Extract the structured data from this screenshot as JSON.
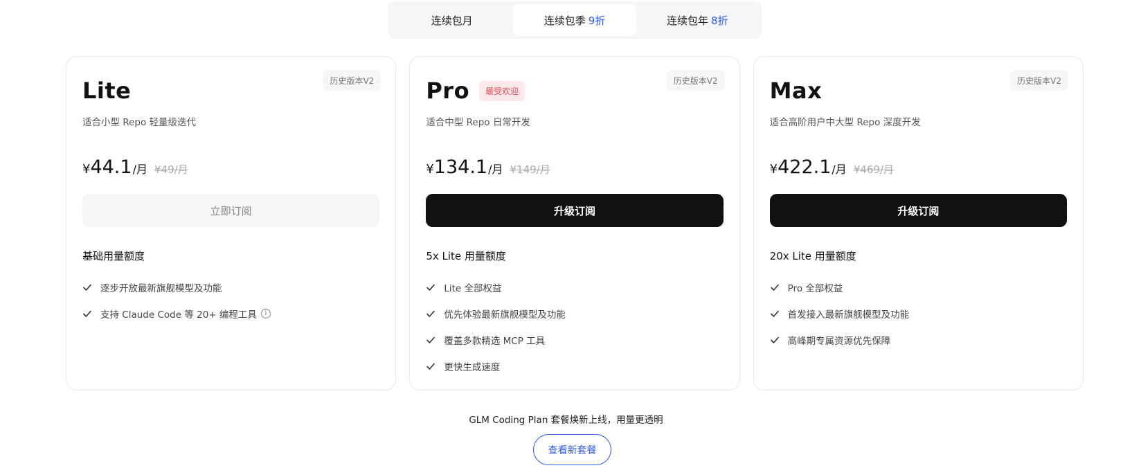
{
  "period_tabs": [
    {
      "label": "连续包月",
      "discount": ""
    },
    {
      "label": "连续包季",
      "discount": "9折"
    },
    {
      "label": "连续包年",
      "discount": "8折"
    }
  ],
  "active_period": 1,
  "plans": [
    {
      "name": "Lite",
      "version": "历史版本V2",
      "popular": "",
      "desc": "适合小型 Repo 轻量级迭代",
      "currency": "¥",
      "price": "44.1",
      "unit": "/月",
      "original": "¥49/月",
      "cta": "立即订阅",
      "quota": "基础用量额度",
      "features": [
        "逐步开放最新旗舰模型及功能",
        "支持 Claude Code 等 20+ 编程工具"
      ]
    },
    {
      "name": "Pro",
      "version": "历史版本V2",
      "popular": "最受欢迎",
      "desc": "适合中型 Repo 日常开发",
      "currency": "¥",
      "price": "134.1",
      "unit": "/月",
      "original": "¥149/月",
      "cta": "升级订阅",
      "quota": "5x Lite 用量额度",
      "features": [
        "Lite 全部权益",
        "优先体验最新旗舰模型及功能",
        "覆盖多款精选 MCP 工具",
        "更快生成速度"
      ]
    },
    {
      "name": "Max",
      "version": "历史版本V2",
      "popular": "",
      "desc": "适合高阶用户中大型 Repo 深度开发",
      "currency": "¥",
      "price": "422.1",
      "unit": "/月",
      "original": "¥469/月",
      "cta": "升级订阅",
      "quota": "20x Lite 用量额度",
      "features": [
        "Pro 全部权益",
        "首发接入最新旗舰模型及功能",
        "高峰期专属资源优先保障"
      ]
    }
  ],
  "info_glyph": "i",
  "bottom": {
    "note": "GLM Coding Plan 套餐焕新上线，用量更透明",
    "button": "查看新套餐"
  },
  "colors": {
    "accent": "#2f5bea",
    "popular": "#e14b5a",
    "primary_button": "#111111"
  }
}
